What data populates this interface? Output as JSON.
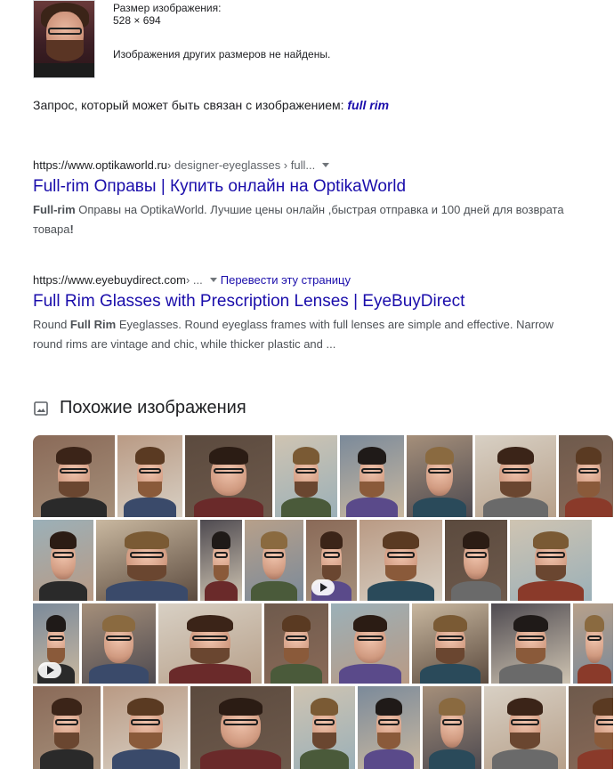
{
  "image_info": {
    "size_label": "Размер изображения:",
    "size_value": "528 × 694",
    "other_sizes": "Изображения других размеров не найдены."
  },
  "query": {
    "prefix": "Запрос, который может быть связан с изображением:",
    "term": "full rim"
  },
  "results": [
    {
      "url_domain": "https://www.optikaworld.ru",
      "url_path": " › designer-eyeglasses › full...",
      "title": "Full-rim Оправы | Купить онлайн на OptikaWorld",
      "snippet_bold1": "Full-rim",
      "snippet_text1": " Оправы на OptikaWorld. Лучшие цены онлайн ,быстрая отправка и 100 дней для возврата товара",
      "snippet_bold2": "!",
      "snippet_text2": ""
    },
    {
      "url_domain": "https://www.eyebuydirect.com",
      "url_path": " › ...",
      "translate": "Перевести эту страницу",
      "title": "Full Rim Glasses with Prescription Lenses | EyeBuyDirect",
      "snippet_pre": "Round ",
      "snippet_bold1": "Full Rim",
      "snippet_text1": " Eyeglasses. Round eyeglass frames with full lenses are simple and effective. Narrow round rims are vintage and chic, while thicker plastic and ..."
    }
  ],
  "similar": {
    "heading": "Похожие изображения",
    "icon": "image-icon"
  },
  "colors": {
    "link": "#1a0dab",
    "text": "#202124",
    "snippet": "#4d5156",
    "url_path": "#5f6368"
  }
}
